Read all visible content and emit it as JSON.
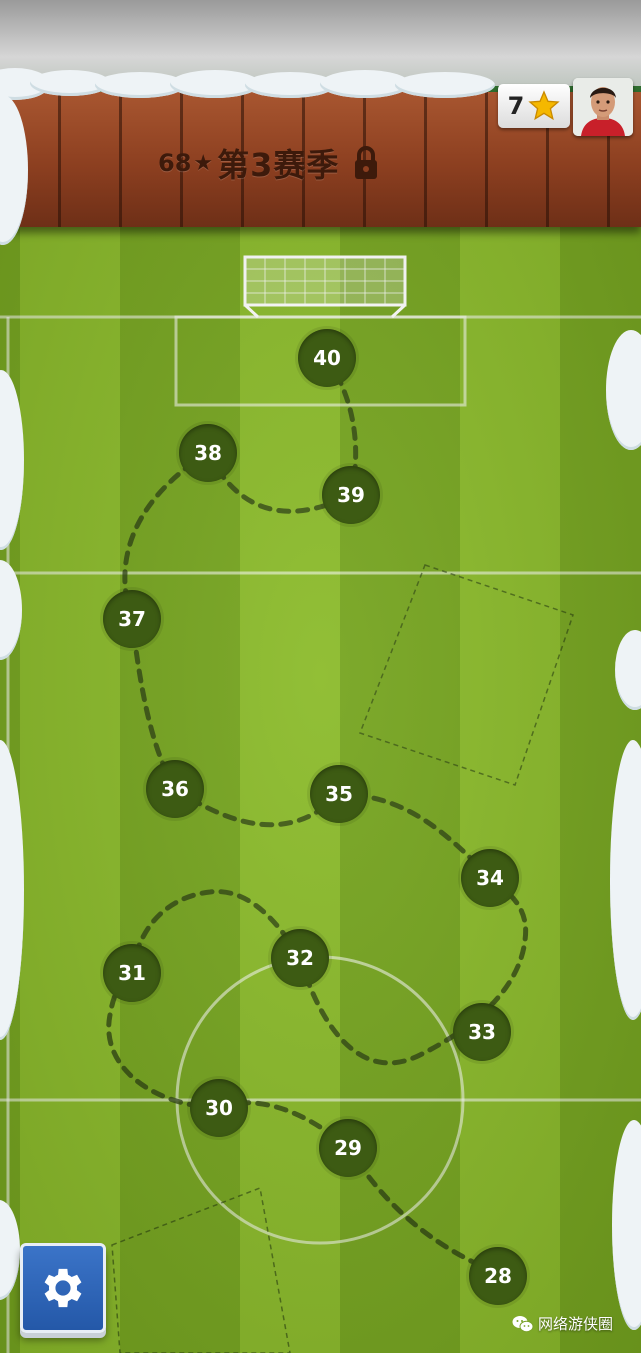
{
  "header": {
    "season_stars": "68",
    "season_title": "第3赛季"
  },
  "hud": {
    "star_count": "7"
  },
  "levels": [
    "28",
    "29",
    "30",
    "31",
    "32",
    "33",
    "34",
    "35",
    "36",
    "37",
    "38",
    "39",
    "40"
  ],
  "icons": {
    "star": "star-icon",
    "lock": "lock-icon",
    "settings": "gear-icon",
    "watermark": "wechat-icon"
  },
  "colors": {
    "node": "#3d5b13",
    "wood": "#8c3f20",
    "settings_button": "#2f65b8",
    "star": "#f5b800"
  },
  "watermark": {
    "text": "网络游侠圈"
  }
}
